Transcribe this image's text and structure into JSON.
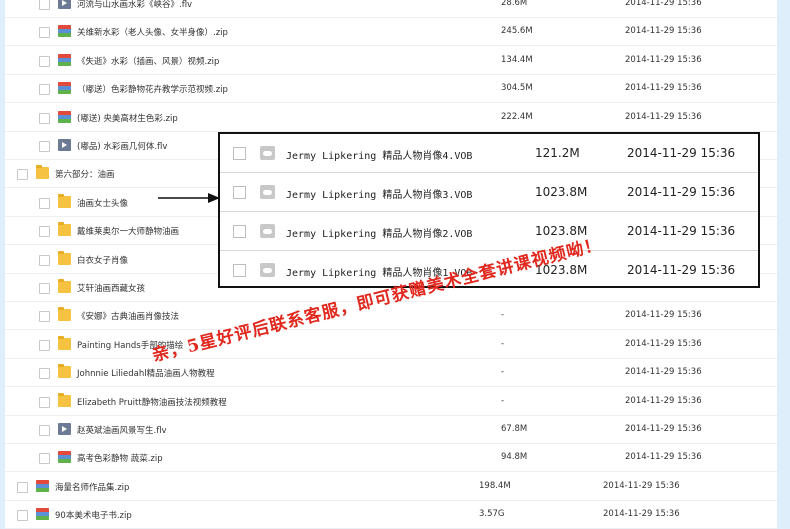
{
  "files": [
    {
      "name": "河流与山水画水彩《峡谷》.flv",
      "size": "28.6M",
      "date": "2014-11-29 15:36",
      "icon": "video-icon",
      "indent": 1
    },
    {
      "name": "关维新水彩（老人头像、女半身像）.zip",
      "size": "245.6M",
      "date": "2014-11-29 15:36",
      "icon": "zip-icon",
      "indent": 1
    },
    {
      "name": "《失逝》水彩（插画、风景）视频.zip",
      "size": "134.4M",
      "date": "2014-11-29 15:36",
      "icon": "zip-icon",
      "indent": 1
    },
    {
      "name": "（嘟送）色彩静物花卉教学示范视频.zip",
      "size": "304.5M",
      "date": "2014-11-29 15:36",
      "icon": "zip-icon",
      "indent": 1
    },
    {
      "name": "(嘟送) 央美高材生色彩.zip",
      "size": "222.4M",
      "date": "2014-11-29 15:36",
      "icon": "zip-icon",
      "indent": 1
    },
    {
      "name": "(嘟品) 水彩画几何体.flv",
      "size": "",
      "date": "",
      "icon": "video-icon",
      "indent": 1
    },
    {
      "name": "第六部分：油画",
      "size": "",
      "date": "",
      "icon": "folder-icon",
      "indent": 0
    },
    {
      "name": "油画女士头像",
      "size": "",
      "date": "",
      "icon": "folder-icon",
      "indent": 1
    },
    {
      "name": "戴维莱奥尔一大师静物油画",
      "size": "",
      "date": "",
      "icon": "folder-icon",
      "indent": 1
    },
    {
      "name": "白衣女子肖像",
      "size": "",
      "date": "",
      "icon": "folder-icon",
      "indent": 1
    },
    {
      "name": "艾轩油画西藏女孩",
      "size": "",
      "date": "",
      "icon": "folder-icon",
      "indent": 1
    },
    {
      "name": "《安娜》古典油画肖像技法",
      "size": "-",
      "date": "2014-11-29 15:36",
      "icon": "folder-icon",
      "indent": 1
    },
    {
      "name": "Painting Hands手部的描绘",
      "size": "-",
      "date": "2014-11-29 15:36",
      "icon": "folder-icon",
      "indent": 1
    },
    {
      "name": "Johnnie Liliedahl精品油画人物教程",
      "size": "-",
      "date": "2014-11-29 15:36",
      "icon": "folder-icon",
      "indent": 1
    },
    {
      "name": "Elizabeth Pruitt静物油画技法视频教程",
      "size": "-",
      "date": "2014-11-29 15:36",
      "icon": "folder-icon",
      "indent": 1
    },
    {
      "name": "赵英斌油画风景写生.flv",
      "size": "67.8M",
      "date": "2014-11-29 15:36",
      "icon": "video-icon",
      "indent": 1
    },
    {
      "name": "高考色彩静物 蔬菜.zip",
      "size": "94.8M",
      "date": "2014-11-29 15:36",
      "icon": "zip-icon",
      "indent": 1
    },
    {
      "name": "海量名师作品集.zip",
      "size": "198.4M",
      "date": "2014-11-29 15:36",
      "icon": "zip-icon",
      "indent": 0
    },
    {
      "name": "90本美术电子书.zip",
      "size": "3.57G",
      "date": "2014-11-29 15:36",
      "icon": "zip-icon",
      "indent": 0
    }
  ],
  "popup": {
    "rows": [
      {
        "name": "Jermy Lipkering 精品人物肖像4.VOB",
        "size": "121.2M",
        "date": "2014-11-29 15:36"
      },
      {
        "name": "Jermy Lipkering 精品人物肖像3.VOB",
        "size": "1023.8M",
        "date": "2014-11-29 15:36"
      },
      {
        "name": "Jermy Lipkering 精品人物肖像2.VOB",
        "size": "1023.8M",
        "date": "2014-11-29 15:36"
      },
      {
        "name": "Jermy Lipkering 精品人物肖像1.VOB",
        "size": "1023.8M",
        "date": "2014-11-29 15:36"
      }
    ]
  },
  "promo_text": "亲，5星好评后联系客服，即可获赠美术全套讲课视频呦！",
  "colors": {
    "promo": "#e0281e",
    "background": "#dfeefb",
    "folder": "#f5c242"
  }
}
